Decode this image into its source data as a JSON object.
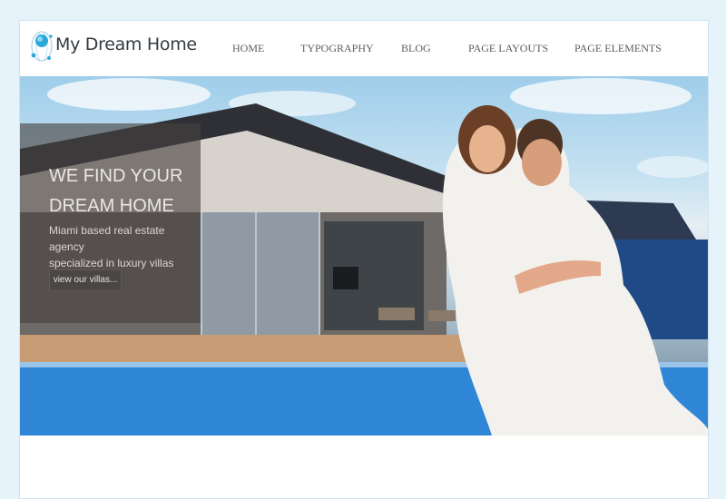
{
  "site": {
    "brand": "My Dream Home"
  },
  "nav": {
    "items": [
      {
        "label": "HOME"
      },
      {
        "label": "TYPOGRAPHY"
      },
      {
        "label": "BLOG"
      },
      {
        "label": "PAGE LAYOUTS"
      },
      {
        "label": "PAGE ELEMENTS"
      }
    ]
  },
  "hero": {
    "title": "WE FIND YOUR\nDREAM HOME",
    "subtitle": "Miami based real estate agency\nspecialized in luxury villas",
    "button_label": "view our villas..."
  },
  "colors": {
    "page_background": "#e6f3fb",
    "overlay": "#46403e",
    "logo_accent": "#2aa9d9"
  }
}
